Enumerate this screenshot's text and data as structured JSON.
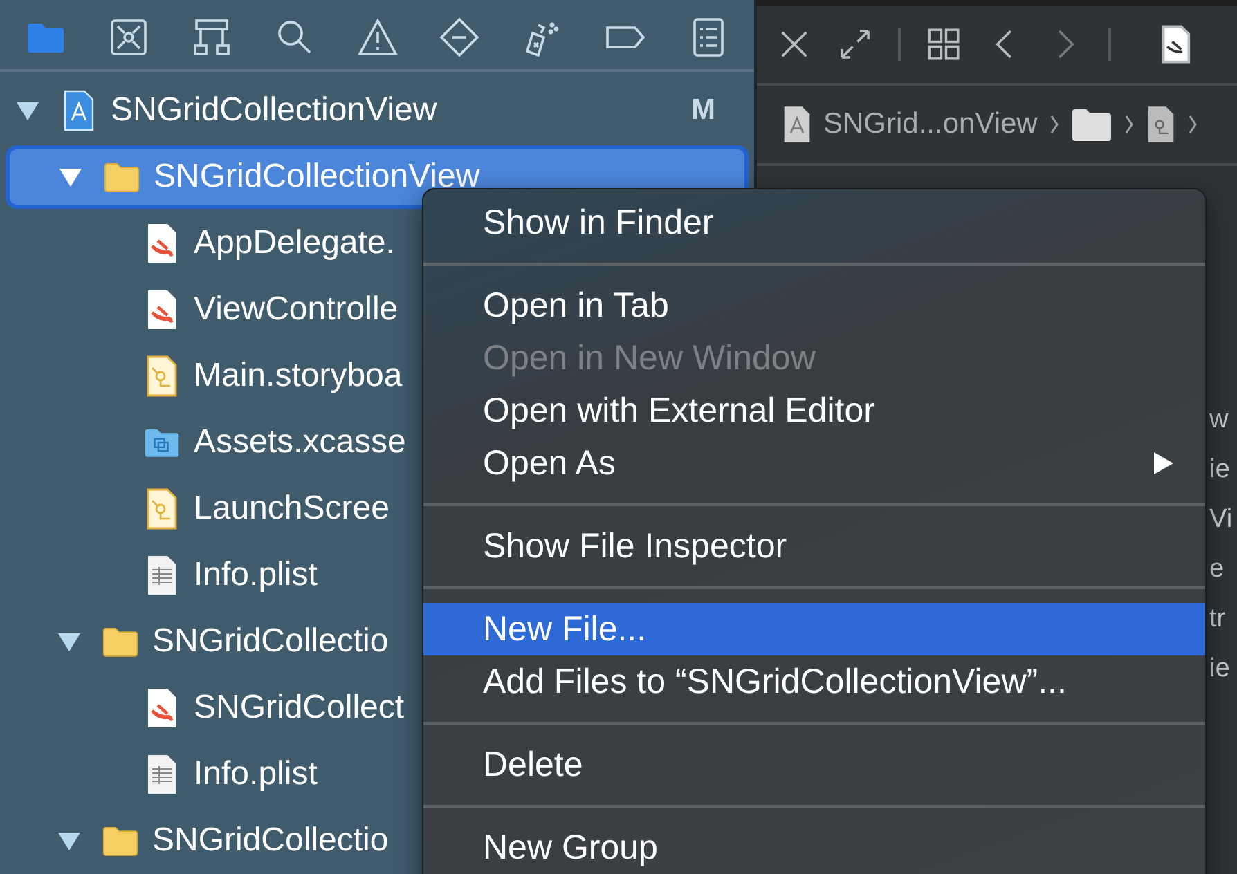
{
  "navigator_tabs": [
    {
      "kind": "folder",
      "selected": true
    },
    {
      "kind": "source-control",
      "selected": false
    },
    {
      "kind": "hierarchy",
      "selected": false
    },
    {
      "kind": "search",
      "selected": false
    },
    {
      "kind": "warning",
      "selected": false
    },
    {
      "kind": "test",
      "selected": false
    },
    {
      "kind": "debug",
      "selected": false
    },
    {
      "kind": "breakpoint",
      "selected": false
    },
    {
      "kind": "report",
      "selected": false
    }
  ],
  "tree": [
    {
      "label": "SNGridCollectionView",
      "kind": "project",
      "badge": "M",
      "expanded": true,
      "selected": false,
      "children": [
        {
          "label": "SNGridCollectionView",
          "kind": "folder",
          "expanded": true,
          "selected": true,
          "children": [
            {
              "label": "AppDelegate.",
              "kind": "swift",
              "selected": false
            },
            {
              "label": "ViewControlle",
              "kind": "swift",
              "selected": false
            },
            {
              "label": "Main.storyboa",
              "kind": "storyboard",
              "selected": false
            },
            {
              "label": "Assets.xcasse",
              "kind": "assets",
              "selected": false
            },
            {
              "label": "LaunchScree",
              "kind": "storyboard",
              "selected": false
            },
            {
              "label": "Info.plist",
              "kind": "plist",
              "selected": false
            }
          ]
        },
        {
          "label": "SNGridCollectio",
          "kind": "folder",
          "expanded": true,
          "selected": false,
          "children": [
            {
              "label": "SNGridCollect",
              "kind": "swift",
              "selected": false
            },
            {
              "label": "Info.plist",
              "kind": "plist",
              "selected": false
            }
          ]
        },
        {
          "label": "SNGridCollectio",
          "kind": "folder",
          "expanded": true,
          "selected": false
        }
      ]
    }
  ],
  "editor_toolbar": [
    {
      "kind": "close"
    },
    {
      "kind": "expand"
    },
    {
      "kind": "divider"
    },
    {
      "kind": "grid"
    },
    {
      "kind": "back"
    },
    {
      "kind": "forward"
    },
    {
      "kind": "divider"
    },
    {
      "kind": "swift-file"
    }
  ],
  "breadcrumb": [
    {
      "kind": "project",
      "label": "SNGrid...onView"
    },
    {
      "kind": "folder"
    },
    {
      "kind": "storyboard"
    }
  ],
  "editor_lines": [
    "w",
    "ie",
    "Vi",
    "e",
    "tr",
    "ie"
  ],
  "context_menu": [
    {
      "kind": "item",
      "label": "Show in Finder",
      "disabled": false,
      "selected": false,
      "submenu": false
    },
    {
      "kind": "separator"
    },
    {
      "kind": "item",
      "label": "Open in Tab",
      "disabled": false,
      "selected": false,
      "submenu": false
    },
    {
      "kind": "item",
      "label": "Open in New Window",
      "disabled": true,
      "selected": false,
      "submenu": false
    },
    {
      "kind": "item",
      "label": "Open with External Editor",
      "disabled": false,
      "selected": false,
      "submenu": false
    },
    {
      "kind": "item",
      "label": "Open As",
      "disabled": false,
      "selected": false,
      "submenu": true
    },
    {
      "kind": "separator"
    },
    {
      "kind": "item",
      "label": "Show File Inspector",
      "disabled": false,
      "selected": false,
      "submenu": false
    },
    {
      "kind": "separator"
    },
    {
      "kind": "item",
      "label": "New File...",
      "disabled": false,
      "selected": true,
      "submenu": false
    },
    {
      "kind": "item",
      "label": "Add Files to “SNGridCollectionView”...",
      "disabled": false,
      "selected": false,
      "submenu": false
    },
    {
      "kind": "separator"
    },
    {
      "kind": "item",
      "label": "Delete",
      "disabled": false,
      "selected": false,
      "submenu": false
    },
    {
      "kind": "separator"
    },
    {
      "kind": "item",
      "label": "New Group",
      "disabled": false,
      "selected": false,
      "submenu": false
    }
  ]
}
